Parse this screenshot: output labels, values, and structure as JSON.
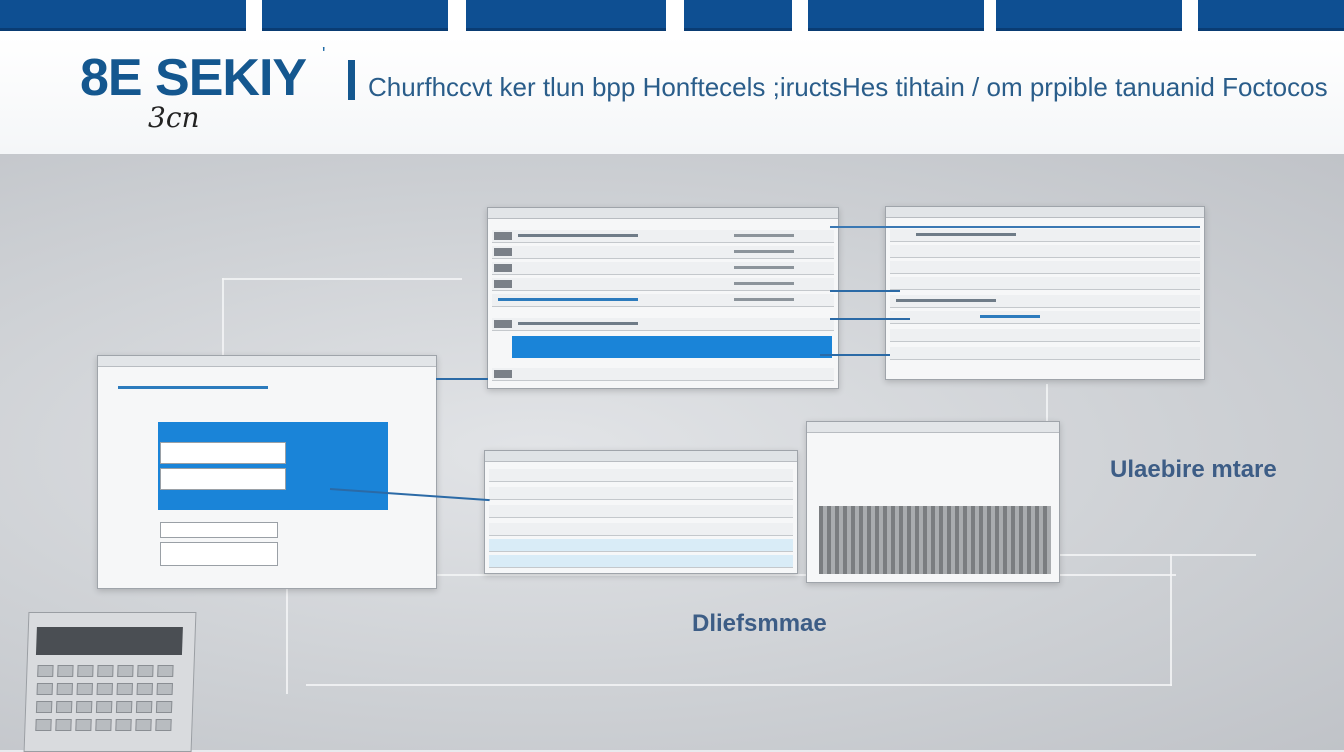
{
  "header": {
    "logo": "8E SEKIY",
    "logo_mark": "'",
    "logo_sub": "3cn",
    "divider": "|",
    "tagline": "Churfhccvt ker tlun bpp Honftecels ;iructsHes tihtain / om prpible tanuanid Foctocos"
  },
  "callouts": {
    "right": "Ulaebire mtare",
    "bottom": "Dliefsmmae"
  },
  "colors": {
    "brand": "#0e4f92",
    "accent": "#1a84d8",
    "callout": "#3d5d86"
  }
}
